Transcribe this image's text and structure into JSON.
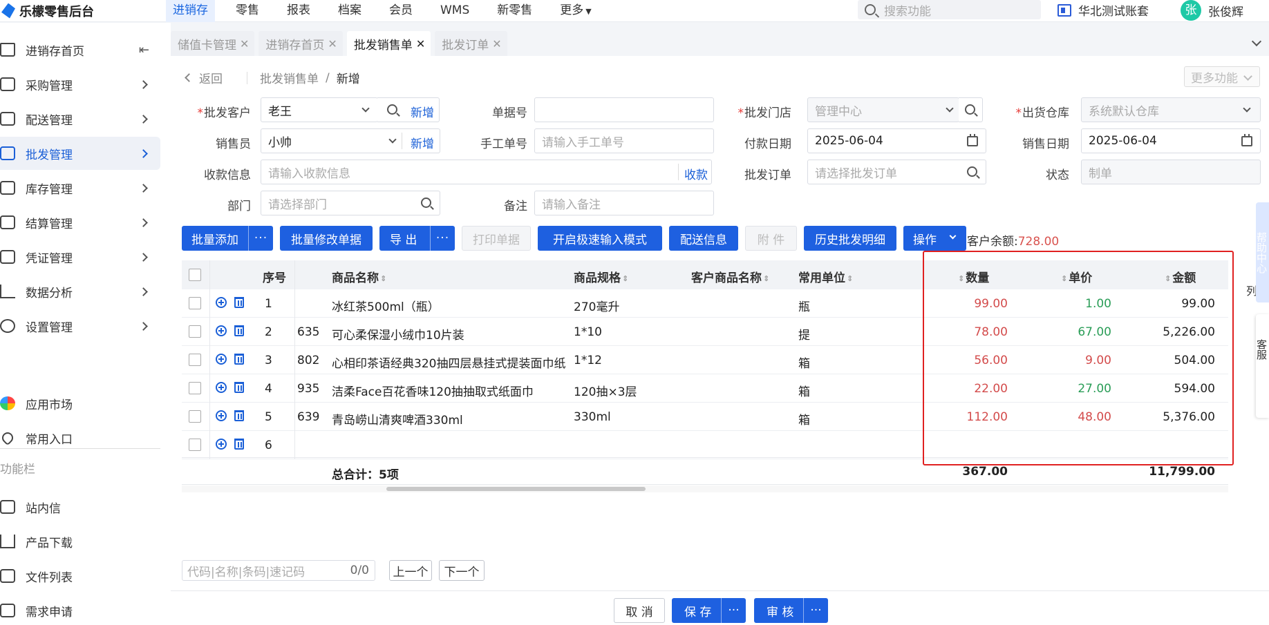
{
  "app": {
    "title": "乐檬零售后台"
  },
  "topnav": {
    "items": [
      "进销存",
      "零售",
      "报表",
      "档案",
      "会员",
      "WMS",
      "新零售",
      "更多"
    ],
    "active": 0,
    "search_placeholder": "搜索功能",
    "account_name": "华北测试账套",
    "avatar_text": "张",
    "user_name": "张俊辉"
  },
  "sidebar": {
    "items": [
      {
        "label": "进销存首页",
        "icon": "home-icon"
      },
      {
        "label": "采购管理",
        "icon": "cart-icon"
      },
      {
        "label": "配送管理",
        "icon": "delivery-icon"
      },
      {
        "label": "批发管理",
        "icon": "wholesale-icon"
      },
      {
        "label": "库存管理",
        "icon": "inventory-icon"
      },
      {
        "label": "结算管理",
        "icon": "settlement-icon"
      },
      {
        "label": "凭证管理",
        "icon": "voucher-icon"
      },
      {
        "label": "数据分析",
        "icon": "chart-icon"
      },
      {
        "label": "设置管理",
        "icon": "settings-icon"
      }
    ],
    "extra": [
      {
        "label": "应用市场",
        "icon": "app-market-icon"
      },
      {
        "label": "常用入口",
        "icon": "heart-icon"
      }
    ],
    "section_title": "功能栏",
    "func_items": [
      {
        "label": "站内信",
        "icon": "mail-icon"
      },
      {
        "label": "产品下载",
        "icon": "download-icon"
      },
      {
        "label": "文件列表",
        "icon": "file-list-icon"
      },
      {
        "label": "需求申请",
        "icon": "request-icon"
      }
    ]
  },
  "tabs": [
    {
      "label": "储值卡管理",
      "active": false
    },
    {
      "label": "进销存首页",
      "active": false
    },
    {
      "label": "批发销售单",
      "active": true
    },
    {
      "label": "批发订单",
      "active": false
    }
  ],
  "breadcrumb": {
    "back": "返回",
    "parent": "批发销售单",
    "current": "新增",
    "more": "更多功能"
  },
  "form": {
    "customer_label": "批发客户",
    "customer_value": "老王",
    "add": "新增",
    "doc_no_label": "单据号",
    "doc_no_value": "",
    "store_label": "批发门店",
    "store_value": "管理中心",
    "warehouse_label": "出货仓库",
    "warehouse_value": "系统默认仓库",
    "salesman_label": "销售员",
    "salesman_value": "小帅",
    "manual_no_label": "手工单号",
    "manual_no_placeholder": "请输入手工单号",
    "pay_date_label": "付款日期",
    "pay_date_value": "2025-06-04",
    "sale_date_label": "销售日期",
    "sale_date_value": "2025-06-04",
    "receipt_label": "收款信息",
    "receipt_placeholder": "请输入收款信息",
    "receipt_action": "收款",
    "order_label": "批发订单",
    "order_placeholder": "请选择批发订单",
    "status_label": "状态",
    "status_value": "制单",
    "dept_label": "部门",
    "dept_placeholder": "请选择部门",
    "remark_label": "备注",
    "remark_placeholder": "请输入备注"
  },
  "toolbar": {
    "batch_add": "批量添加",
    "batch_edit": "批量修改单据",
    "export": "导 出",
    "print": "打印单据",
    "speed_mode": "开启极速输入模式",
    "delivery": "配送信息",
    "attach": "附 件",
    "history": "历史批发明细",
    "operate": "操作",
    "more_dots": "···",
    "balance_label": "客户余额:",
    "balance_value": "728.00"
  },
  "grid": {
    "headers": {
      "seq": "序号",
      "name": "商品名称",
      "spec": "商品规格",
      "cust_name": "客户商品名称",
      "unit": "常用单位",
      "qty": "数量",
      "price": "单价",
      "amount": "金额"
    },
    "rows": [
      {
        "seq": "1",
        "code": "",
        "name": "冰红茶500ml（瓶）",
        "spec": "270毫升",
        "unit": "瓶",
        "qty": "99.00",
        "price": "1.00",
        "price_color": "green",
        "amount": "99.00"
      },
      {
        "seq": "2",
        "code": "635",
        "name": "可心柔保湿小绒巾10片装",
        "spec": "1*10",
        "unit": "提",
        "qty": "78.00",
        "price": "67.00",
        "price_color": "green",
        "amount": "5,226.00"
      },
      {
        "seq": "3",
        "code": "802",
        "name": "心相印茶语经典320抽四层悬挂式提装面巾纸",
        "spec": "1*12",
        "unit": "箱",
        "qty": "56.00",
        "price": "9.00",
        "price_color": "red",
        "amount": "504.00"
      },
      {
        "seq": "4",
        "code": "935",
        "name": "洁柔Face百花香味120抽抽取式纸面巾",
        "spec": "120抽×3层",
        "unit": "箱",
        "qty": "22.00",
        "price": "27.00",
        "price_color": "green",
        "amount": "594.00"
      },
      {
        "seq": "5",
        "code": "639",
        "name": "青岛崂山清爽啤酒330ml",
        "spec": "330ml",
        "unit": "箱",
        "qty": "112.00",
        "price": "48.00",
        "price_color": "red",
        "amount": "5,376.00"
      },
      {
        "seq": "6",
        "code": "",
        "name": "",
        "spec": "",
        "unit": "",
        "qty": "",
        "price": "",
        "price_color": "",
        "amount": ""
      }
    ],
    "total_label": "总合计：5项",
    "total_qty": "367.00",
    "total_amount": "11,799.00",
    "col_setting": "列"
  },
  "pager": {
    "placeholder": "代码|名称|条码|速记码",
    "count": "0/0",
    "prev": "上一个",
    "next": "下一个"
  },
  "bottom": {
    "cancel": "取 消",
    "save": "保 存",
    "audit": "审 核",
    "dots": "···"
  },
  "side_float": {
    "help": "帮助中心",
    "service": "客服"
  }
}
